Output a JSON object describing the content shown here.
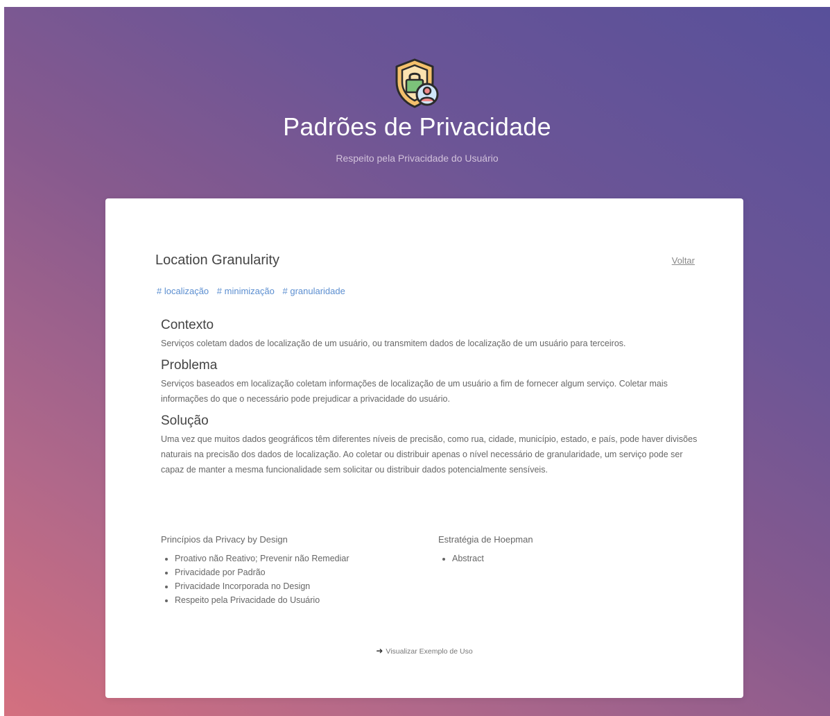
{
  "header": {
    "title": "Padrões de Privacidade",
    "subtitle": "Respeito pela Privacidade do Usuário",
    "logo_icon": "shield-lock-user-icon"
  },
  "pattern": {
    "title": "Location Granularity",
    "back_label": "Voltar",
    "tags": [
      "# localização",
      "# minimização",
      "# granularidade"
    ],
    "sections": [
      {
        "heading": "Contexto",
        "text": "Serviços coletam dados de localização de um usuário, ou transmitem dados de localização de um usuário para terceiros."
      },
      {
        "heading": "Problema",
        "text": "Serviços baseados em localização coletam informações de localização de um usuário a fim de fornecer algum serviço. Coletar mais informações do que o necessário pode prejudicar a privacidade do usuário."
      },
      {
        "heading": "Solução",
        "text": "Uma vez que muitos dados geográficos têm diferentes níveis de precisão, como rua, cidade, município, estado, e país, pode haver divisões naturais na precisão dos dados de localização. Ao coletar ou distribuir apenas o nível necessário de granularidade, um serviço pode ser capaz de manter a mesma funcionalidade sem solicitar ou distribuir dados potencialmente sensíveis."
      }
    ],
    "principles": {
      "heading": "Princípios da Privacy by Design",
      "items": [
        "Proativo não Reativo; Prevenir não Remediar",
        "Privacidade por Padrão",
        "Privacidade Incorporada no Design",
        "Respeito pela Privacidade do Usuário"
      ]
    },
    "strategy": {
      "heading": "Estratégia de Hoepman",
      "items": [
        "Abstract"
      ]
    },
    "example_label": "Visualizar Exemplo de Uso",
    "example_icon": "arrow-right-icon"
  },
  "colors": {
    "gradient_start": "#d4707f",
    "gradient_end": "#58509a",
    "tag": "#5b8ed0"
  }
}
